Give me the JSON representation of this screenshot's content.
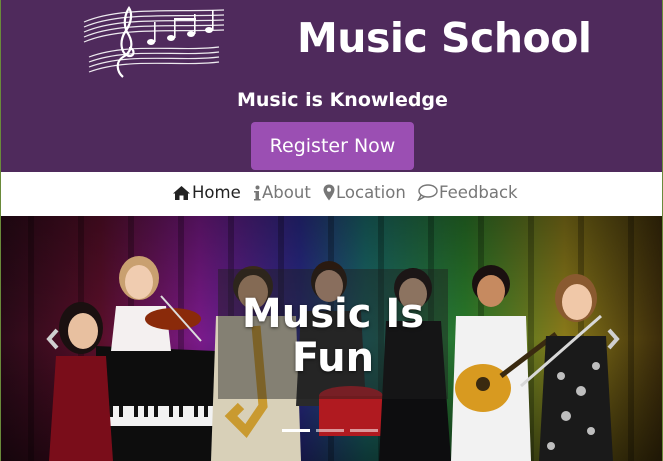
{
  "header": {
    "site_title": "Music School",
    "tagline": "Music is Knowledge",
    "register_label": "Register Now",
    "background_color": "#4f2a5c",
    "button_color": "#9b4fb3",
    "logo_icon": "music-notes-staff-icon"
  },
  "nav": {
    "items": [
      {
        "label": "Home",
        "icon": "home-icon",
        "active": true
      },
      {
        "label": "About",
        "icon": "info-icon",
        "active": false
      },
      {
        "label": "Location",
        "icon": "map-marker-icon",
        "active": false
      },
      {
        "label": "Feedback",
        "icon": "speech-bubble-icon",
        "active": false
      }
    ]
  },
  "carousel": {
    "caption": "Music Is Fun",
    "prev_icon": "chevron-left-icon",
    "next_icon": "chevron-right-icon",
    "slide_count": 3,
    "active_slide": 1
  }
}
